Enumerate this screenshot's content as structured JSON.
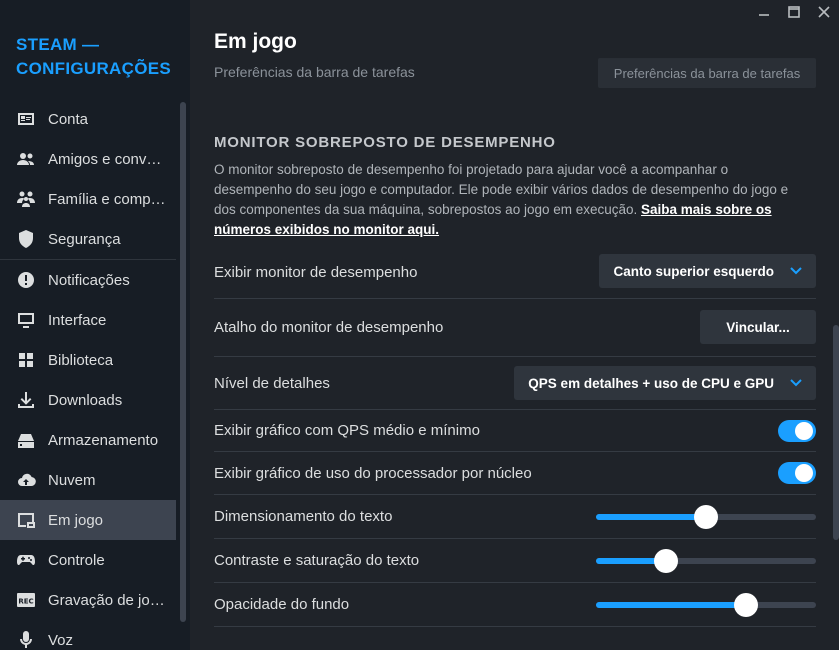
{
  "window": {
    "controls": [
      {
        "name": "minimize-icon"
      },
      {
        "name": "maximize-icon"
      },
      {
        "name": "close-icon"
      }
    ]
  },
  "sidebar": {
    "brand_line1": "STEAM —",
    "brand_line2": "CONFIGURAÇÕES",
    "items": [
      {
        "label": "Conta",
        "icon": "account-card-icon",
        "active": false
      },
      {
        "label": "Amigos e conversas",
        "icon": "friends-icon",
        "active": false
      },
      {
        "label": "Família e compartilhamento",
        "icon": "family-icon",
        "active": false
      },
      {
        "label": "Segurança",
        "icon": "shield-icon",
        "active": false
      },
      {
        "label": "Notificações",
        "icon": "alert-icon",
        "active": false
      },
      {
        "label": "Interface",
        "icon": "monitor-icon",
        "active": false
      },
      {
        "label": "Biblioteca",
        "icon": "grid-icon",
        "active": false
      },
      {
        "label": "Downloads",
        "icon": "download-icon",
        "active": false
      },
      {
        "label": "Armazenamento",
        "icon": "storage-icon",
        "active": false
      },
      {
        "label": "Nuvem",
        "icon": "cloud-icon",
        "active": false
      },
      {
        "label": "Em jogo",
        "icon": "ingame-icon",
        "active": true
      },
      {
        "label": "Controle",
        "icon": "gamepad-icon",
        "active": false
      },
      {
        "label": "Gravação de jogos",
        "icon": "rec-icon",
        "active": false
      },
      {
        "label": "Voz",
        "icon": "microphone-icon",
        "active": false
      }
    ]
  },
  "main": {
    "title": "Em jogo",
    "previous_row": {
      "label": "Preferências da barra de tarefas",
      "button": "Preferências da barra de tarefas"
    },
    "section_title": "MONITOR SOBREPOSTO DE DESEMPENHO",
    "description": "O monitor sobreposto de desempenho foi projetado para ajudar você a acompanhar o desempenho do seu jogo e computador. Ele pode exibir vários dados de desempenho do jogo e dos componentes da sua máquina, sobrepostos ao jogo em execução. ",
    "description_link": "Saiba mais sobre os números exibidos no monitor aqui.",
    "settings": {
      "show_monitor": {
        "label": "Exibir monitor de desempenho",
        "value": "Canto superior esquerdo"
      },
      "shortcut": {
        "label": "Atalho do monitor de desempenho",
        "button": "Vincular..."
      },
      "detail_level": {
        "label": "Nível de detalhes",
        "value": "QPS em detalhes + uso de CPU e GPU"
      },
      "fps_graph": {
        "label": "Exibir gráfico com QPS médio e mínimo",
        "on": true
      },
      "cpu_graph": {
        "label": "Exibir gráfico de uso do processador por núcleo",
        "on": true
      },
      "text_scale": {
        "label": "Dimensionamento do texto",
        "level": 0.5
      },
      "text_contrast": {
        "label": "Contraste e saturação do texto",
        "level": 0.32
      },
      "bg_opacity": {
        "label": "Opacidade do fundo",
        "level": 0.68
      }
    }
  },
  "colors": {
    "accent": "#1a9fff",
    "sidebar_bg": "#171d25",
    "main_bg": "#1f2329",
    "active_item": "#3d4450"
  }
}
